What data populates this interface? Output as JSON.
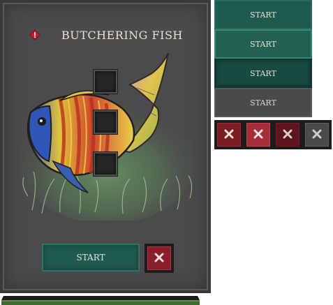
{
  "dialog": {
    "title": "BUTCHERING FISH",
    "start_label": "START"
  },
  "button_states": [
    {
      "state": "normal",
      "label": "START"
    },
    {
      "state": "hover",
      "label": "START"
    },
    {
      "state": "pressed",
      "label": "START"
    },
    {
      "state": "disabled",
      "label": "START"
    }
  ],
  "close_states": [
    "normal",
    "hover",
    "pressed",
    "disabled"
  ],
  "colors": {
    "panel": "#4b4b4b",
    "accent_green": "#1f5a4e",
    "close_red": "#8a1e28",
    "warning_red": "#c0202a",
    "text": "#e8e2d6"
  },
  "icons": {
    "warning": "warning-icon",
    "close": "close-icon"
  }
}
